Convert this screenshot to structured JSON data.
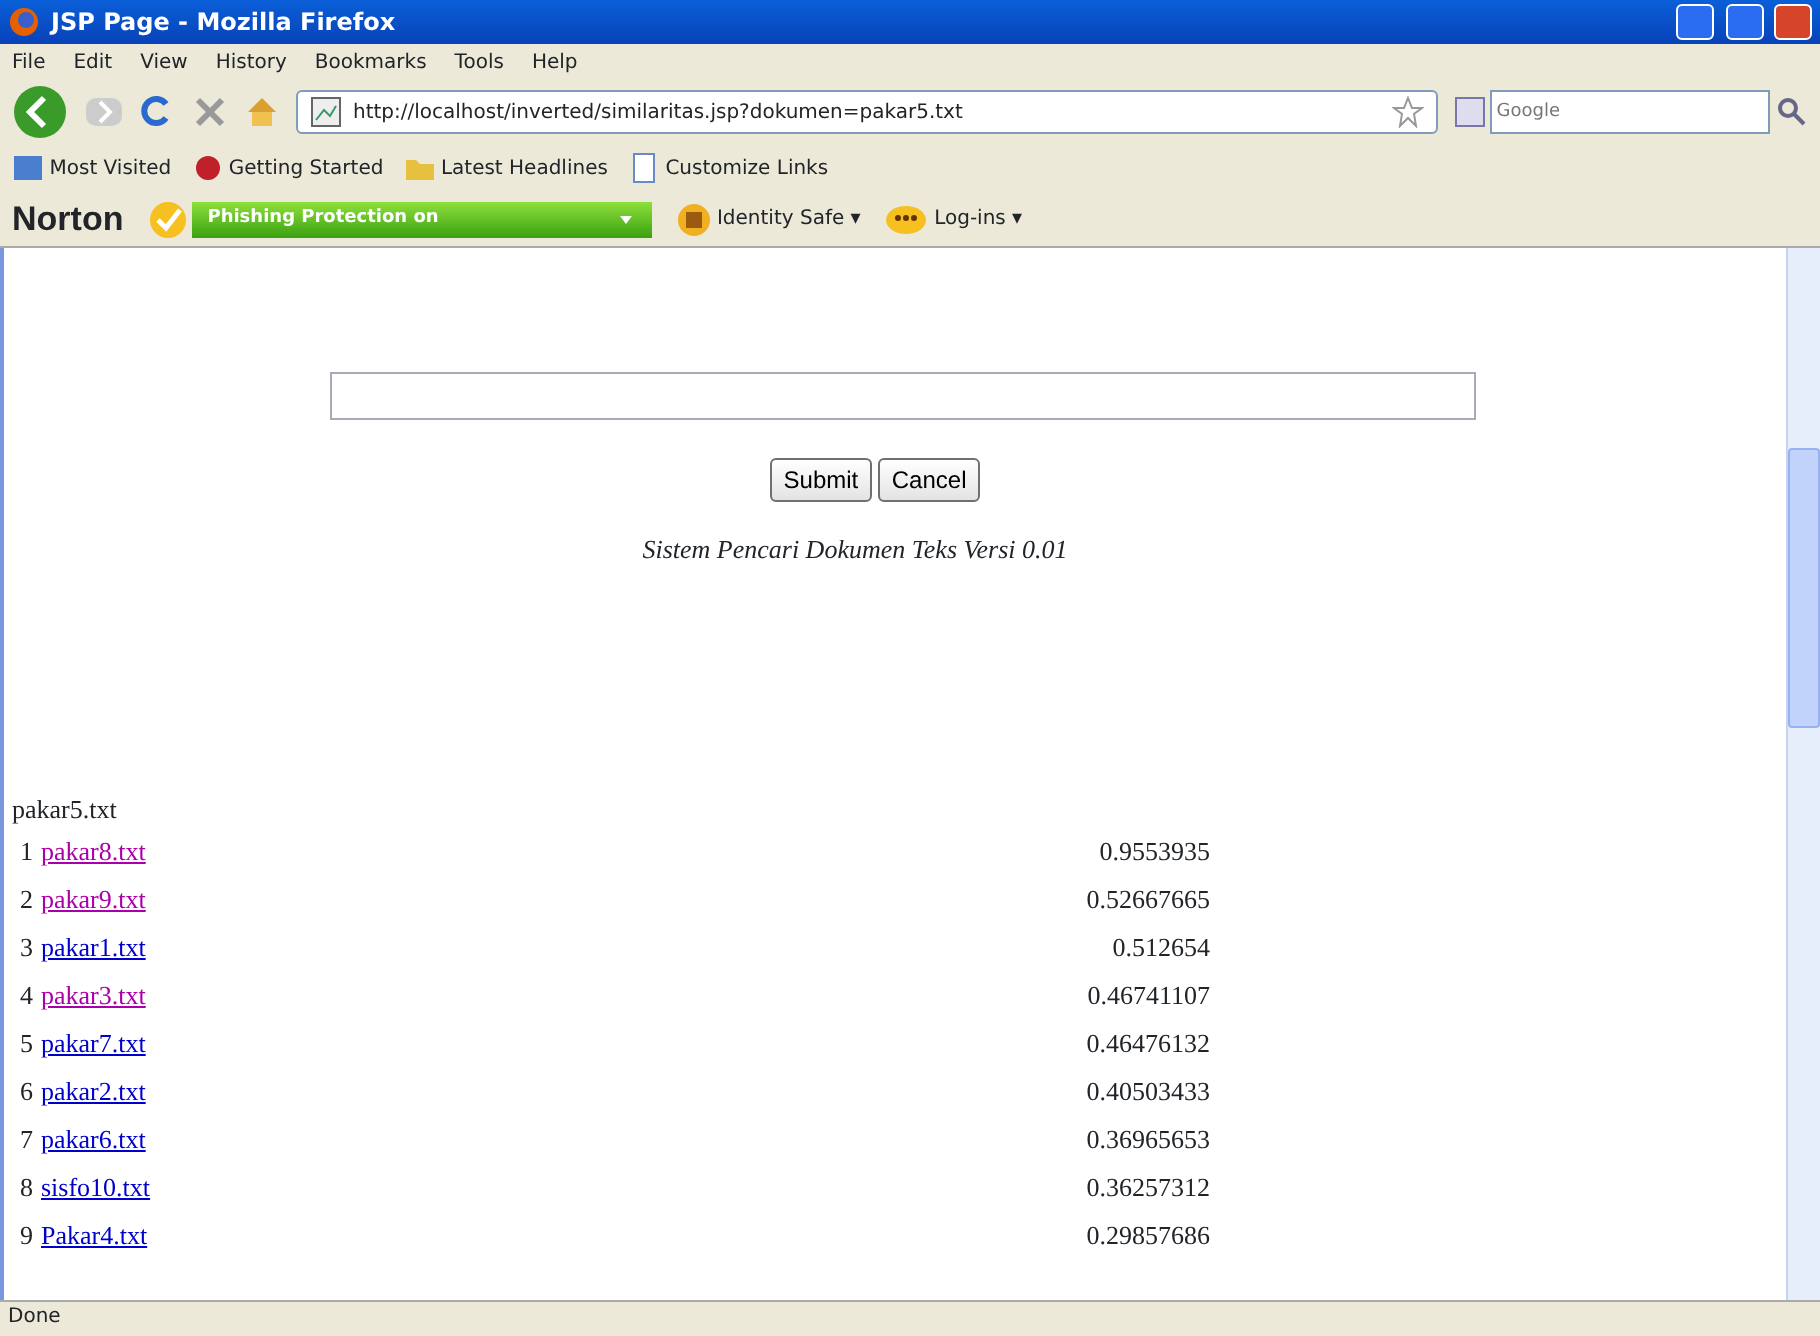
{
  "window": {
    "title": "JSP Page - Mozilla Firefox"
  },
  "menu": [
    "File",
    "Edit",
    "View",
    "History",
    "Bookmarks",
    "Tools",
    "Help"
  ],
  "address": "http://localhost/inverted/similaritas.jsp?dokumen=pakar5.txt",
  "search": {
    "placeholder": "Google"
  },
  "bookmarks": [
    {
      "label": "Most Visited",
      "kind": "rss"
    },
    {
      "label": "Getting Started",
      "kind": "red"
    },
    {
      "label": "Latest Headlines",
      "kind": "folder"
    },
    {
      "label": "Customize Links",
      "kind": "page"
    }
  ],
  "norton": {
    "brand": "Norton",
    "phishing": "Phishing Protection on",
    "items": [
      "Identity Safe ▾",
      "Log-ins ▾"
    ]
  },
  "form": {
    "buttons": [
      "Submit",
      "Cancel"
    ],
    "caption": "Sistem Pencari Dokumen Teks Versi 0.01"
  },
  "query": "pakar5.txt",
  "results": [
    {
      "rank": "1",
      "name": "pakar8.txt",
      "visited": true,
      "score": "0.9553935"
    },
    {
      "rank": "2",
      "name": "pakar9.txt",
      "visited": true,
      "score": "0.52667665"
    },
    {
      "rank": "3",
      "name": "pakar1.txt",
      "visited": false,
      "score": "0.512654"
    },
    {
      "rank": "4",
      "name": "pakar3.txt",
      "visited": true,
      "score": "0.46741107"
    },
    {
      "rank": "5",
      "name": "pakar7.txt",
      "visited": false,
      "score": "0.46476132"
    },
    {
      "rank": "6",
      "name": "pakar2.txt",
      "visited": false,
      "score": "0.40503433"
    },
    {
      "rank": "7",
      "name": "pakar6.txt",
      "visited": false,
      "score": "0.36965653"
    },
    {
      "rank": "8",
      "name": "sisfo10.txt",
      "visited": false,
      "score": "0.36257312"
    },
    {
      "rank": "9",
      "name": "Pakar4.txt",
      "visited": false,
      "score": "0.29857686"
    }
  ],
  "status_bar": "Done"
}
